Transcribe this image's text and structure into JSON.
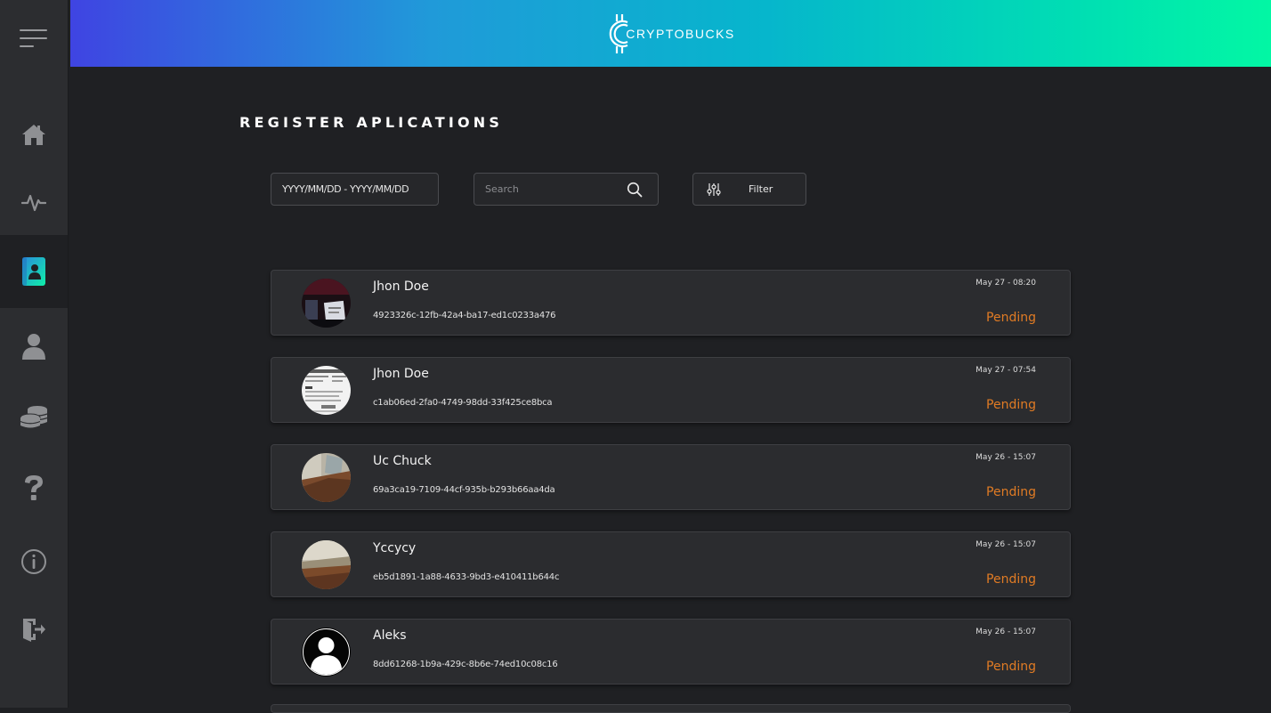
{
  "header": {
    "logo_text": "CRYPTOBUCKS"
  },
  "sidebar": {
    "items": [
      {
        "name": "home-icon"
      },
      {
        "name": "activity-icon"
      },
      {
        "name": "contact-book-icon",
        "active": true
      },
      {
        "name": "user-icon"
      },
      {
        "name": "coins-icon"
      },
      {
        "name": "question-icon"
      },
      {
        "name": "info-icon"
      },
      {
        "name": "logout-icon"
      }
    ]
  },
  "main": {
    "title": "REGISTER APLICATIONS",
    "date_range_placeholder": "YYYY/MM/DD - YYYY/MM/DD",
    "search_placeholder": "Search",
    "filter_label": "Filter"
  },
  "applications": [
    {
      "name": "Jhon Doe",
      "id": "4923326c-12fb-42a4-ba17-ed1c0233a476",
      "date": "May 27 - 08:20",
      "status": "Pending"
    },
    {
      "name": "Jhon Doe",
      "id": "c1ab06ed-2fa0-4749-98dd-33f425ce8bca",
      "date": "May 27 - 07:54",
      "status": "Pending"
    },
    {
      "name": "Uc Chuck",
      "id": "69a3ca19-7109-44cf-935b-b293b66aa4da",
      "date": "May 26 - 15:07",
      "status": "Pending"
    },
    {
      "name": "Yccycy",
      "id": "eb5d1891-1a88-4633-9bd3-e410411b644c",
      "date": "May 26 - 15:07",
      "status": "Pending"
    },
    {
      "name": "Aleks",
      "id": "8dd61268-1b9a-429c-8b6e-74ed10c08c16",
      "date": "May 26 - 15:07",
      "status": "Pending"
    }
  ],
  "colors": {
    "status_pending": "#e07b24",
    "gradient_start": "#3f44e2",
    "gradient_end": "#02f7a4",
    "active_icon": "#13c8b0"
  }
}
